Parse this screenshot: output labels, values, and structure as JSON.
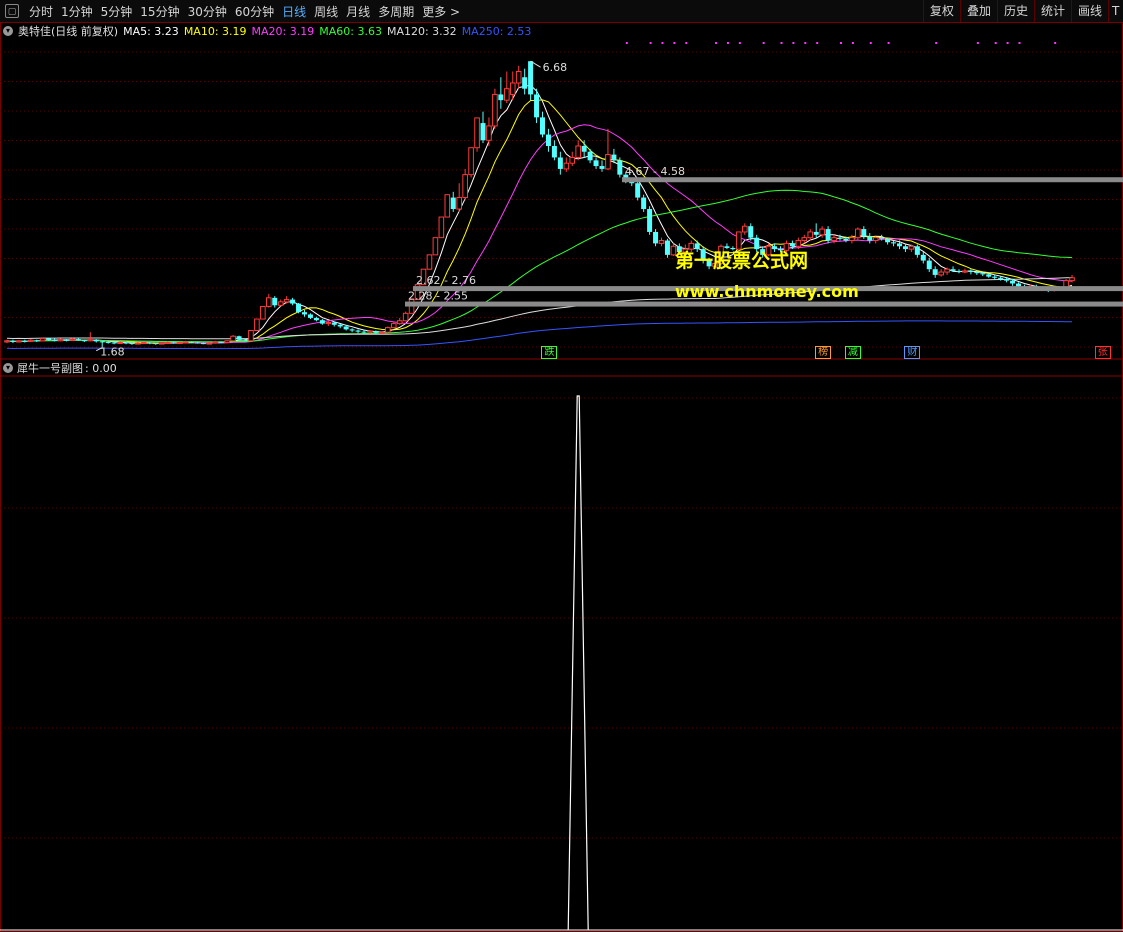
{
  "toolbar": {
    "periods": [
      "分时",
      "1分钟",
      "5分钟",
      "15分钟",
      "30分钟",
      "60分钟",
      "日线",
      "周线",
      "月线",
      "多周期",
      "更多 >"
    ],
    "active_period": "日线",
    "right_buttons": [
      "复权",
      "叠加",
      "历史",
      "统计",
      "画线",
      "T"
    ]
  },
  "legend": {
    "title": "奥特佳(日线 前复权)",
    "items": [
      {
        "text": "MA5: 3.23",
        "color": "#ffffff"
      },
      {
        "text": "MA10: 3.19",
        "color": "#ffff00"
      },
      {
        "text": "MA20: 3.19",
        "color": "#ff3cff"
      },
      {
        "text": "MA60: 3.63",
        "color": "#33ff33"
      },
      {
        "text": "MA120: 3.32",
        "color": "#dddddd"
      },
      {
        "text": "MA250: 2.53",
        "color": "#3355ff"
      }
    ]
  },
  "sub_legend": {
    "title": "犀牛一号副图",
    "value": ": 0.00"
  },
  "watermark": {
    "line1": "第一股票公式网",
    "line2": "www.chnmoney.com"
  },
  "chart_data": {
    "type": "candlestick",
    "price_range": [
      1.5,
      7.05
    ],
    "annotations": [
      {
        "text": "6.68",
        "price": 6.68,
        "bar": 88
      },
      {
        "text": "1.68",
        "price": 1.68,
        "bar": 16
      },
      {
        "text": "4.67 - 4.58",
        "price": 4.62
      },
      {
        "text": "2.62 - 2.76",
        "price": 2.72
      },
      {
        "text": "2.28 - 2.55",
        "price": 2.45
      }
    ],
    "events": [
      {
        "text": "跌",
        "color": "#33ff33",
        "bar": 91
      },
      {
        "text": "榜",
        "color": "#ff9933",
        "bar": 137
      },
      {
        "text": "减",
        "color": "#33ff33",
        "bar": 142
      },
      {
        "text": "财",
        "color": "#5599ff",
        "bar": 152
      },
      {
        "text": "张",
        "color": "#ff3333",
        "bar": 184
      }
    ],
    "candles": [
      [
        1.78,
        1.8,
        1.82,
        1.76
      ],
      [
        1.8,
        1.78,
        1.82,
        1.76
      ],
      [
        1.78,
        1.8,
        1.81,
        1.77
      ],
      [
        1.8,
        1.79,
        1.82,
        1.77
      ],
      [
        1.79,
        1.81,
        1.83,
        1.78
      ],
      [
        1.81,
        1.8,
        1.82,
        1.78
      ],
      [
        1.8,
        1.84,
        1.86,
        1.79
      ],
      [
        1.84,
        1.82,
        1.85,
        1.8
      ],
      [
        1.82,
        1.8,
        1.84,
        1.79
      ],
      [
        1.8,
        1.82,
        1.84,
        1.79
      ],
      [
        1.82,
        1.81,
        1.83,
        1.79
      ],
      [
        1.81,
        1.83,
        1.85,
        1.8
      ],
      [
        1.83,
        1.81,
        1.84,
        1.8
      ],
      [
        1.81,
        1.8,
        1.82,
        1.78
      ],
      [
        1.8,
        1.82,
        1.95,
        1.79
      ],
      [
        1.82,
        1.79,
        1.83,
        1.77
      ],
      [
        1.79,
        1.78,
        1.8,
        1.68
      ],
      [
        1.78,
        1.77,
        1.79,
        1.75
      ],
      [
        1.77,
        1.76,
        1.78,
        1.74
      ],
      [
        1.76,
        1.77,
        1.79,
        1.75
      ],
      [
        1.77,
        1.76,
        1.78,
        1.74
      ],
      [
        1.76,
        1.75,
        1.77,
        1.73
      ],
      [
        1.75,
        1.76,
        1.78,
        1.74
      ],
      [
        1.76,
        1.77,
        1.78,
        1.75
      ],
      [
        1.77,
        1.76,
        1.78,
        1.74
      ],
      [
        1.76,
        1.75,
        1.77,
        1.73
      ],
      [
        1.75,
        1.76,
        1.78,
        1.74
      ],
      [
        1.76,
        1.77,
        1.79,
        1.75
      ],
      [
        1.77,
        1.76,
        1.78,
        1.75
      ],
      [
        1.76,
        1.77,
        1.78,
        1.75
      ],
      [
        1.77,
        1.78,
        1.8,
        1.76
      ],
      [
        1.78,
        1.77,
        1.79,
        1.76
      ],
      [
        1.77,
        1.76,
        1.78,
        1.75
      ],
      [
        1.76,
        1.75,
        1.77,
        1.74
      ],
      [
        1.75,
        1.76,
        1.78,
        1.74
      ],
      [
        1.76,
        1.78,
        1.8,
        1.75
      ],
      [
        1.78,
        1.77,
        1.79,
        1.76
      ],
      [
        1.77,
        1.8,
        1.81,
        1.76
      ],
      [
        1.8,
        1.88,
        1.9,
        1.79
      ],
      [
        1.88,
        1.82,
        1.89,
        1.8
      ],
      [
        1.82,
        1.8,
        1.84,
        1.79
      ],
      [
        1.8,
        1.98,
        1.98,
        1.8
      ],
      [
        1.98,
        2.18,
        2.18,
        1.98
      ],
      [
        2.18,
        2.4,
        2.4,
        2.18
      ],
      [
        2.4,
        2.55,
        2.62,
        2.38
      ],
      [
        2.55,
        2.42,
        2.58,
        2.38
      ],
      [
        2.42,
        2.48,
        2.52,
        2.4
      ],
      [
        2.48,
        2.52,
        2.58,
        2.45
      ],
      [
        2.52,
        2.45,
        2.55,
        2.42
      ],
      [
        2.45,
        2.3,
        2.46,
        2.28
      ],
      [
        2.3,
        2.26,
        2.34,
        2.22
      ],
      [
        2.26,
        2.2,
        2.28,
        2.18
      ],
      [
        2.2,
        2.16,
        2.22,
        2.14
      ],
      [
        2.16,
        2.1,
        2.18,
        2.08
      ],
      [
        2.1,
        2.12,
        2.15,
        2.06
      ],
      [
        2.12,
        2.08,
        2.14,
        2.05
      ],
      [
        2.08,
        2.05,
        2.1,
        2.02
      ],
      [
        2.05,
        2.0,
        2.08,
        1.98
      ],
      [
        2.0,
        1.98,
        2.02,
        1.95
      ],
      [
        1.98,
        1.96,
        2.0,
        1.93
      ],
      [
        1.96,
        1.95,
        1.99,
        1.93
      ],
      [
        1.95,
        1.97,
        1.99,
        1.93
      ],
      [
        1.97,
        1.94,
        1.98,
        1.92
      ],
      [
        1.94,
        1.95,
        1.97,
        1.92
      ],
      [
        1.95,
        2.03,
        2.05,
        1.94
      ],
      [
        2.03,
        2.1,
        2.12,
        2.02
      ],
      [
        2.1,
        2.15,
        2.2,
        2.08
      ],
      [
        2.15,
        2.28,
        2.31,
        2.14
      ],
      [
        2.28,
        2.52,
        2.52,
        2.28
      ],
      [
        2.52,
        2.78,
        2.78,
        2.52
      ],
      [
        2.78,
        3.05,
        3.05,
        2.78
      ],
      [
        3.05,
        3.3,
        3.3,
        3.05
      ],
      [
        3.3,
        3.6,
        3.6,
        3.3
      ],
      [
        3.6,
        3.96,
        3.96,
        3.6
      ],
      [
        3.96,
        4.35,
        4.35,
        3.96
      ],
      [
        4.3,
        4.1,
        4.4,
        4.05
      ],
      [
        4.1,
        4.3,
        4.55,
        4.05
      ],
      [
        4.3,
        4.7,
        4.8,
        4.25
      ],
      [
        4.7,
        5.17,
        5.17,
        4.65
      ],
      [
        5.17,
        5.69,
        5.69,
        5.1
      ],
      [
        5.6,
        5.3,
        5.8,
        5.25
      ],
      [
        5.3,
        5.55,
        5.7,
        5.2
      ],
      [
        5.55,
        6.1,
        6.2,
        5.5
      ],
      [
        6.1,
        6.0,
        6.4,
        5.85
      ],
      [
        6.0,
        6.2,
        6.5,
        5.95
      ],
      [
        6.1,
        6.3,
        6.5,
        6.0
      ],
      [
        6.3,
        6.5,
        6.6,
        6.2
      ],
      [
        6.4,
        6.2,
        6.55,
        6.1
      ],
      [
        6.68,
        6.1,
        6.68,
        6.0
      ],
      [
        6.1,
        5.7,
        6.2,
        5.6
      ],
      [
        5.7,
        5.4,
        5.8,
        5.35
      ],
      [
        5.4,
        5.2,
        5.5,
        5.1
      ],
      [
        5.2,
        5.0,
        5.3,
        4.95
      ],
      [
        5.0,
        4.8,
        5.1,
        4.7
      ],
      [
        4.8,
        4.9,
        5.0,
        4.75
      ],
      [
        4.9,
        5.0,
        5.1,
        4.85
      ],
      [
        5.0,
        5.2,
        5.3,
        4.95
      ],
      [
        5.2,
        5.1,
        5.3,
        5.0
      ],
      [
        5.1,
        4.95,
        5.15,
        4.9
      ],
      [
        4.95,
        4.85,
        5.0,
        4.8
      ],
      [
        4.85,
        4.8,
        4.95,
        4.75
      ],
      [
        4.8,
        5.05,
        5.5,
        4.78
      ],
      [
        5.05,
        4.95,
        5.15,
        4.9
      ],
      [
        4.95,
        4.7,
        5.0,
        4.65
      ],
      [
        4.7,
        4.6,
        4.75,
        4.55
      ],
      [
        4.6,
        4.55,
        4.65,
        4.5
      ],
      [
        4.55,
        4.3,
        4.6,
        4.25
      ],
      [
        4.3,
        4.1,
        4.35,
        4.05
      ],
      [
        4.1,
        3.7,
        4.15,
        3.65
      ],
      [
        3.7,
        3.5,
        3.75,
        3.45
      ],
      [
        3.5,
        3.55,
        3.6,
        3.45
      ],
      [
        3.55,
        3.3,
        3.58,
        3.25
      ],
      [
        3.3,
        3.45,
        3.5,
        3.28
      ],
      [
        3.45,
        3.35,
        3.5,
        3.3
      ],
      [
        3.35,
        3.4,
        3.48,
        3.3
      ],
      [
        3.4,
        3.5,
        3.55,
        3.35
      ],
      [
        3.5,
        3.4,
        3.55,
        3.35
      ],
      [
        3.4,
        3.2,
        3.45,
        3.15
      ],
      [
        3.2,
        3.1,
        3.25,
        3.05
      ],
      [
        3.1,
        3.15,
        3.2,
        3.05
      ],
      [
        3.15,
        3.45,
        3.48,
        3.12
      ],
      [
        3.45,
        3.42,
        3.5,
        3.4
      ],
      [
        3.42,
        3.4,
        3.45,
        3.38
      ],
      [
        3.4,
        3.7,
        3.7,
        3.4
      ],
      [
        3.7,
        3.8,
        3.85,
        3.65
      ],
      [
        3.8,
        3.6,
        3.85,
        3.55
      ],
      [
        3.6,
        3.4,
        3.65,
        3.35
      ],
      [
        3.4,
        3.3,
        3.45,
        3.25
      ],
      [
        3.3,
        3.45,
        3.5,
        3.28
      ],
      [
        3.45,
        3.4,
        3.5,
        3.35
      ],
      [
        3.4,
        3.38,
        3.45,
        3.35
      ],
      [
        3.38,
        3.5,
        3.55,
        3.35
      ],
      [
        3.5,
        3.45,
        3.55,
        3.4
      ],
      [
        3.45,
        3.55,
        3.6,
        3.4
      ],
      [
        3.55,
        3.6,
        3.65,
        3.5
      ],
      [
        3.6,
        3.7,
        3.75,
        3.55
      ],
      [
        3.7,
        3.65,
        3.85,
        3.6
      ],
      [
        3.65,
        3.75,
        3.8,
        3.6
      ],
      [
        3.75,
        3.55,
        3.8,
        3.5
      ],
      [
        3.55,
        3.6,
        3.65,
        3.5
      ],
      [
        3.6,
        3.58,
        3.65,
        3.55
      ],
      [
        3.58,
        3.55,
        3.62,
        3.52
      ],
      [
        3.55,
        3.6,
        3.65,
        3.5
      ],
      [
        3.6,
        3.75,
        3.78,
        3.55
      ],
      [
        3.75,
        3.62,
        3.8,
        3.58
      ],
      [
        3.62,
        3.55,
        3.68,
        3.5
      ],
      [
        3.55,
        3.6,
        3.62,
        3.5
      ],
      [
        3.6,
        3.58,
        3.65,
        3.55
      ],
      [
        3.58,
        3.52,
        3.6,
        3.48
      ],
      [
        3.52,
        3.5,
        3.55,
        3.45
      ],
      [
        3.5,
        3.45,
        3.55,
        3.4
      ],
      [
        3.45,
        3.4,
        3.5,
        3.35
      ],
      [
        3.4,
        3.45,
        3.48,
        3.35
      ],
      [
        3.45,
        3.3,
        3.48,
        3.25
      ],
      [
        3.3,
        3.2,
        3.35,
        3.15
      ],
      [
        3.2,
        3.05,
        3.25,
        3.0
      ],
      [
        3.05,
        2.95,
        3.1,
        2.9
      ],
      [
        2.95,
        3.0,
        3.05,
        2.92
      ],
      [
        3.0,
        3.05,
        3.08,
        2.95
      ],
      [
        3.05,
        3.02,
        3.1,
        3.0
      ],
      [
        3.02,
        3.0,
        3.05,
        2.98
      ],
      [
        3.0,
        3.02,
        3.06,
        2.98
      ],
      [
        3.02,
        3.0,
        3.05,
        2.96
      ],
      [
        3.0,
        2.98,
        3.02,
        2.95
      ],
      [
        2.98,
        2.96,
        3.0,
        2.93
      ],
      [
        2.96,
        2.92,
        2.98,
        2.9
      ],
      [
        2.92,
        2.9,
        2.95,
        2.87
      ],
      [
        2.9,
        2.88,
        2.92,
        2.85
      ],
      [
        2.88,
        2.85,
        2.9,
        2.82
      ],
      [
        2.85,
        2.8,
        2.88,
        2.76
      ],
      [
        2.8,
        2.75,
        2.82,
        2.72
      ],
      [
        2.75,
        2.72,
        2.78,
        2.7
      ],
      [
        2.72,
        2.75,
        2.78,
        2.7
      ],
      [
        2.75,
        2.72,
        2.78,
        2.7
      ],
      [
        2.72,
        2.7,
        2.75,
        2.68
      ],
      [
        2.7,
        2.68,
        2.72,
        2.65
      ],
      [
        2.68,
        2.7,
        2.73,
        2.66
      ],
      [
        2.7,
        2.72,
        2.75,
        2.68
      ],
      [
        2.72,
        2.85,
        2.88,
        2.7
      ],
      [
        2.85,
        2.9,
        2.95,
        2.82
      ]
    ],
    "subchart": {
      "title": "犀牛一号副图",
      "peak_bar": 96,
      "peak_value": 1,
      "range": [
        0,
        1
      ]
    }
  }
}
